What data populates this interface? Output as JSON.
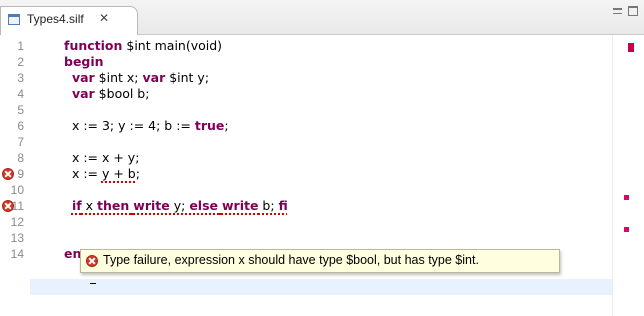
{
  "tab": {
    "title": "Types4.silf",
    "close_glyph": "✕"
  },
  "view_controls": {
    "minimize_icon": "minimize-icon",
    "maximize_icon": "maximize-icon"
  },
  "editor": {
    "lines": [
      {
        "num": "1",
        "text": [
          {
            "t": "function",
            "k": true
          },
          {
            "t": " $int main(void)",
            "k": false
          }
        ]
      },
      {
        "num": "2",
        "text": [
          {
            "t": "begin",
            "k": true
          }
        ]
      },
      {
        "num": "3",
        "text": [
          {
            "t": "  ",
            "k": false
          },
          {
            "t": "var",
            "k": true
          },
          {
            "t": " $int x; ",
            "k": false
          },
          {
            "t": "var",
            "k": true
          },
          {
            "t": " $int y;",
            "k": false
          }
        ]
      },
      {
        "num": "4",
        "text": [
          {
            "t": "  ",
            "k": false
          },
          {
            "t": "var",
            "k": true
          },
          {
            "t": " $bool b;",
            "k": false
          }
        ]
      },
      {
        "num": "5",
        "text": []
      },
      {
        "num": "6",
        "text": [
          {
            "t": "  x := 3; y := 4; b := ",
            "k": false
          },
          {
            "t": "true",
            "k": true
          },
          {
            "t": ";",
            "k": false
          }
        ]
      },
      {
        "num": "7",
        "text": []
      },
      {
        "num": "8",
        "text": [
          {
            "t": "  x := x + y;",
            "k": false
          }
        ]
      },
      {
        "num": "9",
        "error": true,
        "text": [
          {
            "t": "  x := ",
            "k": false
          },
          {
            "t": "y + b",
            "k": false,
            "e": true
          },
          {
            "t": ";",
            "k": false
          }
        ]
      },
      {
        "num": "10",
        "text": []
      },
      {
        "num": "11",
        "error": true,
        "text": [
          {
            "t": "  ",
            "k": false
          },
          {
            "t": "if",
            "k": true,
            "e": true
          },
          {
            "t": " x ",
            "k": false,
            "e": true
          },
          {
            "t": "then",
            "k": true,
            "e": true
          },
          {
            "t": " ",
            "k": false,
            "e": true
          },
          {
            "t": "write",
            "k": true,
            "e": true
          },
          {
            "t": " y; ",
            "k": false,
            "e": true
          },
          {
            "t": "else",
            "k": true,
            "e": true
          },
          {
            "t": " ",
            "k": false,
            "e": true
          },
          {
            "t": "write",
            "k": true,
            "e": true
          },
          {
            "t": " b; ",
            "k": false,
            "e": true
          },
          {
            "t": "fi",
            "k": true,
            "e": true
          }
        ]
      },
      {
        "num": "12",
        "text": []
      },
      {
        "num": "13",
        "text": []
      },
      {
        "num": "14",
        "text": [
          {
            "t": "en",
            "k": true
          }
        ]
      }
    ]
  },
  "tooltip": {
    "message": "Type failure, expression x should have type $bool, but has type $int."
  },
  "colors": {
    "keyword": "#7f0055",
    "error": "#d33a2c",
    "current_line": "#e8f2fe",
    "tooltip_bg": "#ffffe0"
  }
}
